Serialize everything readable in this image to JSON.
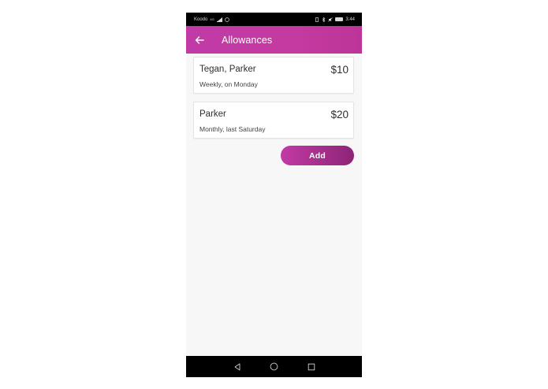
{
  "status_bar": {
    "carrier": "Koodo",
    "network": "4G",
    "battery_level": "100",
    "time": "3:44"
  },
  "app_bar": {
    "back_icon": "arrow-left-icon",
    "title": "Allowances",
    "background_color": "#c53aa0"
  },
  "allowances": [
    {
      "name": "Tegan, Parker",
      "amount": "$10",
      "schedule": "Weekly, on Monday"
    },
    {
      "name": "Parker",
      "amount": "$20",
      "schedule": "Monthly, last Saturday"
    }
  ],
  "add_button": {
    "label": "Add",
    "gradient_start": "#c13aa6",
    "gradient_end": "#8d2576"
  },
  "nav_bar": {
    "icons": [
      "back-triangle-icon",
      "home-circle-icon",
      "recents-square-icon"
    ]
  }
}
